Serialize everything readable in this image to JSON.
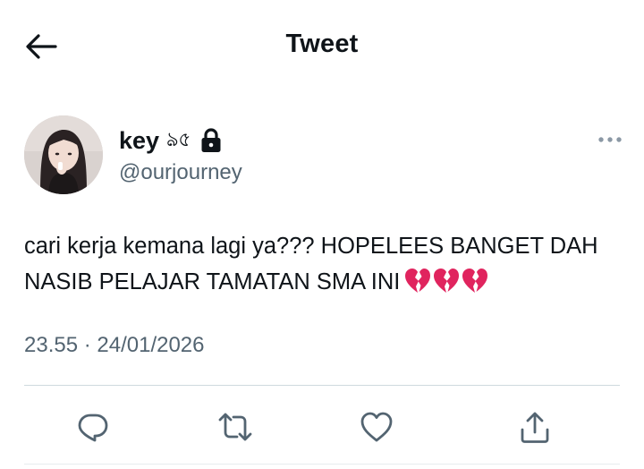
{
  "header": {
    "title": "Tweet",
    "back_icon": "arrow-left-icon"
  },
  "author": {
    "name": "key",
    "name_decoration": "ঌ৫",
    "handle": "@ourjourney",
    "protected_icon": "lock-icon",
    "avatar": "profile-photo"
  },
  "tweet": {
    "text": "cari kerja kemana lagi ya??? HOPELEES BANGET DAH NASIB PELAJAR TAMATAN SMA INI",
    "emoji": [
      "broken-heart-icon",
      "broken-heart-icon",
      "broken-heart-icon"
    ],
    "timestamp": "23.55 · 24/01/2026"
  },
  "actions": [
    "reply-icon",
    "retweet-icon",
    "like-icon",
    "share-icon"
  ],
  "colors": {
    "text": "#0f1419",
    "secondary": "#536471",
    "divider": "#cfd9de",
    "heart_red": "#e0245e"
  }
}
